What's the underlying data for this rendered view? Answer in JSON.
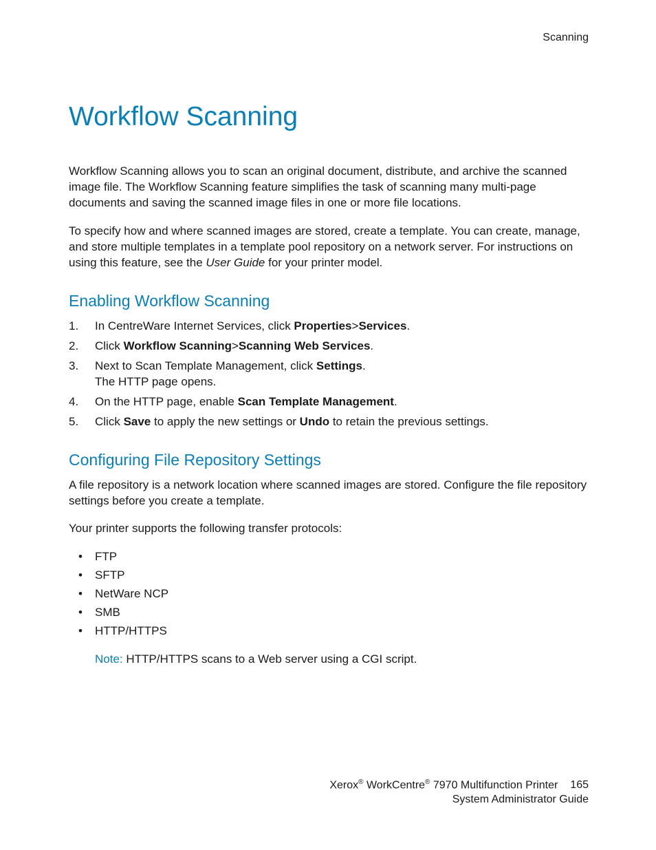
{
  "header": {
    "tag": "Scanning"
  },
  "title": "Workflow Scanning",
  "intro1": "Workflow Scanning allows you to scan an original document, distribute, and archive the scanned image file. The Workflow Scanning feature simplifies the task of scanning many multi-page documents and saving the scanned image files in one or more file locations.",
  "intro2_a": "To specify how and where scanned images are stored, create a template. You can create, manage, and store multiple templates in a template pool repository on a network server. For instructions on using this feature, see the ",
  "intro2_italic": "User Guide",
  "intro2_b": " for your printer model.",
  "section1": {
    "heading": "Enabling Workflow Scanning",
    "steps": [
      {
        "pre": "In CentreWare Internet Services, click ",
        "b1": "Properties",
        "mid": ">",
        "b2": "Services",
        "post": "."
      },
      {
        "pre": "Click ",
        "b1": "Workflow Scanning",
        "mid": ">",
        "b2": "Scanning Web Services",
        "post": "."
      },
      {
        "pre": "Next to Scan Template Management, click ",
        "b1": "Settings",
        "post": ".",
        "line2": "The HTTP page opens."
      },
      {
        "pre": "On the HTTP page, enable ",
        "b1": "Scan Template Management",
        "post": "."
      },
      {
        "pre": "Click ",
        "b1": "Save",
        "mid": " to apply the new settings or ",
        "b2": "Undo",
        "post": " to retain the previous settings."
      }
    ]
  },
  "section2": {
    "heading": "Configuring File Repository Settings",
    "para1": "A file repository is a network location where scanned images are stored. Configure the file repository settings before you create a template.",
    "para2": "Your printer supports the following transfer protocols:",
    "bullets": [
      "FTP",
      "SFTP",
      "NetWare NCP",
      "SMB",
      "HTTP/HTTPS"
    ],
    "note_label": "Note:",
    "note_text": " HTTP/HTTPS scans to a Web server using a CGI script."
  },
  "footer": {
    "brand1": "Xerox",
    "reg": "®",
    "brand2": " WorkCentre",
    "model": " 7970 Multifunction Printer",
    "page": "165",
    "line2": "System Administrator Guide"
  }
}
